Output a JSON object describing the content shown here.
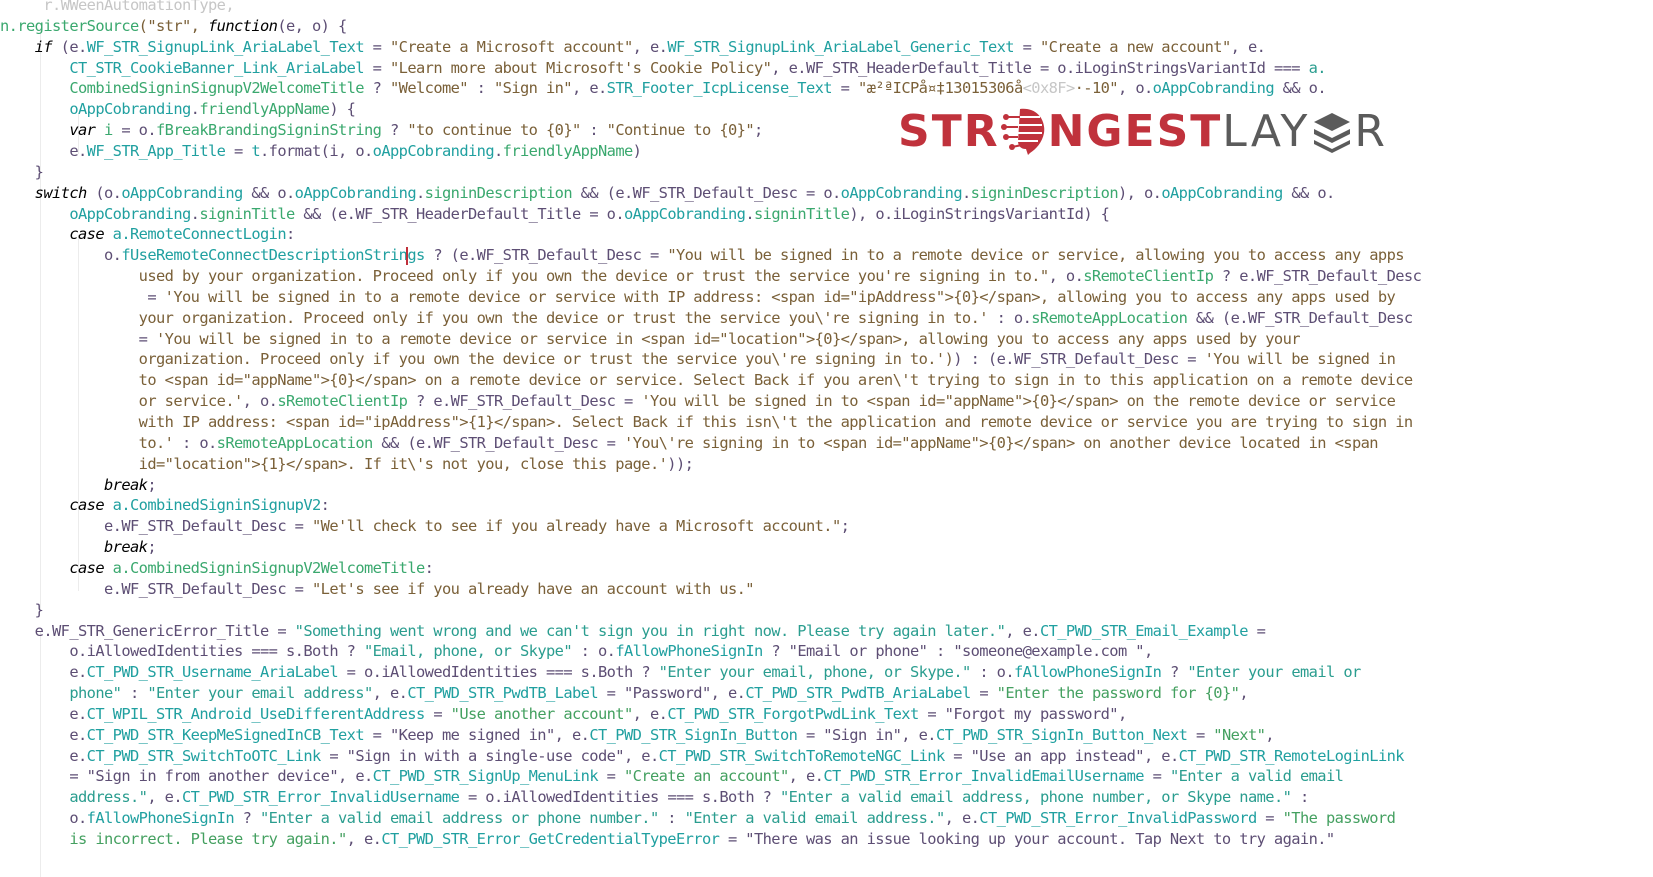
{
  "logo": {
    "part1": "STR",
    "part2": "NGEST",
    "part3": "LAY",
    "part4": "R",
    "colors": {
      "primary": "#c0323c",
      "secondary": "#5b5b5b"
    }
  },
  "code": {
    "lines": [
      [
        [
          "pl",
          "     "
        ],
        [
          "ghost",
          "r.WWeenAutomationType,"
        ]
      ],
      [
        [
          "fn",
          "n.registerSource"
        ],
        [
          "str",
          "(\"str\", "
        ],
        [
          "kw",
          "function"
        ],
        [
          "pl",
          "(e, o) {"
        ]
      ],
      [
        [
          "pl",
          "    "
        ],
        [
          "kw",
          "if"
        ],
        [
          "pl",
          " (e."
        ],
        [
          "prop",
          "WF_STR_SignupLink_AriaLabel_Text"
        ],
        [
          "pl",
          " = "
        ],
        [
          "str",
          "\"Create a Microsoft account\""
        ],
        [
          "pl",
          ", e."
        ],
        [
          "prop",
          "WF_STR_SignupLink_AriaLabel_Generic_Text"
        ],
        [
          "pl",
          " = "
        ],
        [
          "str",
          "\"Create a new account\""
        ],
        [
          "pl",
          ", e."
        ]
      ],
      [
        [
          "pl",
          "        "
        ],
        [
          "prop",
          "CT_STR_CookieBanner_Link_AriaLabel"
        ],
        [
          "pl",
          " = "
        ],
        [
          "str",
          "\"Learn more about Microsoft's Cookie Policy\""
        ],
        [
          "pl",
          ", e."
        ],
        [
          "pl",
          "WF_STR_HeaderDefault_Title"
        ],
        [
          "pl",
          " = o."
        ],
        [
          "pl",
          "iLoginStringsVariantId"
        ],
        [
          "pl",
          " === "
        ],
        [
          "teal",
          "a."
        ]
      ],
      [
        [
          "pl",
          "        "
        ],
        [
          "fn",
          "CombinedSigninSignupV2WelcomeTitle"
        ],
        [
          "pl",
          " ? "
        ],
        [
          "str",
          "\"Welcome\""
        ],
        [
          "pl",
          " : "
        ],
        [
          "str",
          "\"Sign in\""
        ],
        [
          "pl",
          ", e."
        ],
        [
          "prop",
          "STR_Footer_IcpLicense_Text"
        ],
        [
          "pl",
          " = "
        ],
        [
          "str",
          "\"æ²ªICPå¤‡13015306å"
        ],
        [
          "ghost",
          "<0x8F>"
        ],
        [
          "str",
          "·-10\""
        ],
        [
          "pl",
          ", o."
        ],
        [
          "prop",
          "oAppCobranding"
        ],
        [
          "pl",
          " && o."
        ]
      ],
      [
        [
          "pl",
          "        "
        ],
        [
          "prop",
          "oAppCobranding"
        ],
        [
          "pl",
          "."
        ],
        [
          "fn",
          "friendlyAppName"
        ],
        [
          "pl",
          ") {"
        ]
      ],
      [
        [
          "pl",
          "        "
        ],
        [
          "kw",
          "var"
        ],
        [
          "pl",
          " "
        ],
        [
          "fn",
          "i"
        ],
        [
          "pl",
          " = o."
        ],
        [
          "fn",
          "fBreakBrandingSigninString"
        ],
        [
          "pl",
          " ? "
        ],
        [
          "str",
          "\"to continue to {0}\""
        ],
        [
          "pl",
          " : "
        ],
        [
          "str",
          "\"Continue to {0}\""
        ],
        [
          "pl",
          ";"
        ]
      ],
      [
        [
          "pl",
          "        e."
        ],
        [
          "prop",
          "WF_STR_App_Title"
        ],
        [
          "pl",
          " = "
        ],
        [
          "prop",
          "t"
        ],
        [
          "pl",
          ".format(i, o."
        ],
        [
          "prop",
          "oAppCobranding"
        ],
        [
          "pl",
          "."
        ],
        [
          "fn",
          "friendlyAppName"
        ],
        [
          "pl",
          ")"
        ]
      ],
      [
        [
          "pl",
          "    }"
        ]
      ],
      [
        [
          "pl",
          "    "
        ],
        [
          "kw",
          "switch"
        ],
        [
          "pl",
          " (o."
        ],
        [
          "prop",
          "oAppCobranding"
        ],
        [
          "pl",
          " && o."
        ],
        [
          "prop",
          "oAppCobranding"
        ],
        [
          "pl",
          "."
        ],
        [
          "fn",
          "signinDescription"
        ],
        [
          "pl",
          " && (e."
        ],
        [
          "pl",
          "WF_STR_Default_Desc"
        ],
        [
          "pl",
          " = o."
        ],
        [
          "prop",
          "oAppCobranding"
        ],
        [
          "pl",
          "."
        ],
        [
          "fn",
          "signinDescription"
        ],
        [
          "pl",
          "), o."
        ],
        [
          "prop",
          "oAppCobranding"
        ],
        [
          "pl",
          " && o."
        ]
      ],
      [
        [
          "pl",
          "        "
        ],
        [
          "prop",
          "oAppCobranding"
        ],
        [
          "pl",
          "."
        ],
        [
          "fn",
          "signinTitle"
        ],
        [
          "pl",
          " && (e."
        ],
        [
          "pl",
          "WF_STR_HeaderDefault_Title"
        ],
        [
          "pl",
          " = o."
        ],
        [
          "prop",
          "oAppCobranding"
        ],
        [
          "pl",
          "."
        ],
        [
          "fn",
          "signinTitle"
        ],
        [
          "pl",
          "), o."
        ],
        [
          "pl",
          "iLoginStringsVariantId"
        ],
        [
          "pl",
          ") {"
        ]
      ],
      [
        [
          "pl",
          "        "
        ],
        [
          "kw",
          "case"
        ],
        [
          "pl",
          " "
        ],
        [
          "prop",
          "a.RemoteConnectLogin"
        ],
        [
          "pl",
          ":"
        ]
      ],
      [
        [
          "pl",
          "            o."
        ],
        [
          "prop",
          "fUseRemoteConnectDescriptionStrin"
        ],
        [
          "caret",
          ""
        ],
        [
          "prop",
          "gs"
        ],
        [
          "pl",
          " ? (e."
        ],
        [
          "pl",
          "WF_STR_Default_Desc"
        ],
        [
          "pl",
          " = "
        ],
        [
          "str",
          "\"You will be signed in to a remote device or service, allowing you to access any apps"
        ]
      ],
      [
        [
          "str",
          "                used by your organization. Proceed only if you own the device or trust the service you're signing in to.\""
        ],
        [
          "pl",
          ", o."
        ],
        [
          "fn",
          "sRemoteClientIp"
        ],
        [
          "pl",
          " ? e."
        ],
        [
          "pl",
          "WF_STR_Default_Desc"
        ]
      ],
      [
        [
          "pl",
          "                 = "
        ],
        [
          "str",
          "'You will be signed in to a remote device or service with IP address: <span id=\"ipAddress\">{0}</span>, allowing you to access any apps used by"
        ]
      ],
      [
        [
          "str",
          "                your organization. Proceed only if you own the device or trust the service you\\'re signing in to.'"
        ],
        [
          "pl",
          " : o."
        ],
        [
          "fn",
          "sRemoteAppLocation"
        ],
        [
          "pl",
          " && (e."
        ],
        [
          "pl",
          "WF_STR_Default_Desc"
        ]
      ],
      [
        [
          "pl",
          "                = "
        ],
        [
          "str",
          "'You will be signed in to a remote device or service in <span id=\"location\">{0}</span>, allowing you to access any apps used by your"
        ]
      ],
      [
        [
          "str",
          "                organization. Proceed only if you own the device or trust the service you\\'re signing in to.')"
        ],
        [
          "pl",
          ") : (e."
        ],
        [
          "pl",
          "WF_STR_Default_Desc"
        ],
        [
          "pl",
          " = "
        ],
        [
          "str",
          "'You will be signed in"
        ]
      ],
      [
        [
          "str",
          "                to <span id=\"appName\">{0}</span> on a remote device or service. Select Back if you aren\\'t trying to sign in to this application on a remote device"
        ]
      ],
      [
        [
          "str",
          "                or service.'"
        ],
        [
          "pl",
          ", o."
        ],
        [
          "fn",
          "sRemoteClientIp"
        ],
        [
          "pl",
          " ? e."
        ],
        [
          "pl",
          "WF_STR_Default_Desc"
        ],
        [
          "pl",
          " = "
        ],
        [
          "str",
          "'You will be signed in to <span id=\"appName\">{0}</span> on the remote device or service"
        ]
      ],
      [
        [
          "str",
          "                with IP address: <span id=\"ipAddress\">{1}</span>. Select Back if this isn\\'t the application and remote device or service you are trying to sign in"
        ]
      ],
      [
        [
          "str",
          "                to.'"
        ],
        [
          "pl",
          " : o."
        ],
        [
          "fn",
          "sRemoteAppLocation"
        ],
        [
          "pl",
          " && (e."
        ],
        [
          "pl",
          "WF_STR_Default_Desc"
        ],
        [
          "pl",
          " = "
        ],
        [
          "str",
          "'You\\'re signing in to <span id=\"appName\">{0}</span> on another device located in <span"
        ]
      ],
      [
        [
          "str",
          "                id=\"location\">{1}</span>. If it\\'s not you, close this page.'"
        ],
        [
          "pl",
          "));"
        ]
      ],
      [
        [
          "pl",
          "            "
        ],
        [
          "kw",
          "break"
        ],
        [
          "pl",
          ";"
        ]
      ],
      [
        [
          "pl",
          "        "
        ],
        [
          "kw",
          "case"
        ],
        [
          "pl",
          " "
        ],
        [
          "prop",
          "a.CombinedSigninSignupV2"
        ],
        [
          "pl",
          ":"
        ]
      ],
      [
        [
          "pl",
          "            e."
        ],
        [
          "pl",
          "WF_STR_Default_Desc"
        ],
        [
          "pl",
          " = "
        ],
        [
          "str",
          "\"We'll check to see if you already have a Microsoft account.\""
        ],
        [
          "pl",
          ";"
        ]
      ],
      [
        [
          "pl",
          "            "
        ],
        [
          "kw",
          "break"
        ],
        [
          "pl",
          ";"
        ]
      ],
      [
        [
          "pl",
          "        "
        ],
        [
          "kw",
          "case"
        ],
        [
          "pl",
          " "
        ],
        [
          "fn",
          "a.CombinedSigninSignupV2WelcomeTitle"
        ],
        [
          "pl",
          ":"
        ]
      ],
      [
        [
          "pl",
          "            e."
        ],
        [
          "pl",
          "WF_STR_Default_Desc"
        ],
        [
          "pl",
          " = "
        ],
        [
          "str",
          "\"Let's see if you already have an account with us.\""
        ]
      ],
      [
        [
          "pl",
          "    }"
        ]
      ],
      [
        [
          "pl",
          "    e."
        ],
        [
          "pl",
          "WF_STR_GenericError_Title"
        ],
        [
          "pl",
          " = "
        ],
        [
          "teal",
          "\"Something went wrong and we can't sign you in right now. Please try again later.\""
        ],
        [
          "pl",
          ", e."
        ],
        [
          "prop",
          "CT_PWD_STR_Email_Example"
        ],
        [
          "pl",
          " ="
        ]
      ],
      [
        [
          "pl",
          "        o."
        ],
        [
          "pl",
          "iAllowedIdentities"
        ],
        [
          "pl",
          " === s.Both ? "
        ],
        [
          "teal",
          "\"Email, phone, or Skype\""
        ],
        [
          "pl",
          " : o."
        ],
        [
          "prop",
          "fAllowPhoneSignIn"
        ],
        [
          "pl",
          " ? "
        ],
        [
          "pl",
          "\"Email or phone\""
        ],
        [
          "pl",
          " : "
        ],
        [
          "pl",
          "\"someone@example.com \""
        ],
        [
          "pl",
          ","
        ]
      ],
      [
        [
          "pl",
          "        e."
        ],
        [
          "prop",
          "CT_PWD_STR_Username_AriaLabel"
        ],
        [
          "pl",
          " = o."
        ],
        [
          "pl",
          "iAllowedIdentities"
        ],
        [
          "pl",
          " === s.Both ? "
        ],
        [
          "teal",
          "\"Enter your email, phone, or Skype.\""
        ],
        [
          "pl",
          " : o."
        ],
        [
          "prop",
          "fAllowPhoneSignIn"
        ],
        [
          "pl",
          " ? "
        ],
        [
          "teal",
          "\"Enter your email or"
        ]
      ],
      [
        [
          "teal",
          "        phone\""
        ],
        [
          "pl",
          " : "
        ],
        [
          "teal",
          "\"Enter your email address\""
        ],
        [
          "pl",
          ", e."
        ],
        [
          "prop",
          "CT_PWD_STR_PwdTB_Label"
        ],
        [
          "pl",
          " = "
        ],
        [
          "pl",
          "\"Password\""
        ],
        [
          "pl",
          ", e."
        ],
        [
          "prop",
          "CT_PWD_STR_PwdTB_AriaLabel"
        ],
        [
          "pl",
          " = "
        ],
        [
          "grn",
          "\"Enter the password for {0}\""
        ],
        [
          "pl",
          ","
        ]
      ],
      [
        [
          "pl",
          "        e."
        ],
        [
          "prop",
          "CT_WPIL_STR_Android_UseDifferentAddress"
        ],
        [
          "pl",
          " = "
        ],
        [
          "grn",
          "\"Use another account\""
        ],
        [
          "pl",
          ", e."
        ],
        [
          "prop",
          "CT_PWD_STR_ForgotPwdLink_Text"
        ],
        [
          "pl",
          " = "
        ],
        [
          "pl",
          "\"Forgot my password\""
        ],
        [
          "pl",
          ","
        ]
      ],
      [
        [
          "pl",
          "        e."
        ],
        [
          "prop",
          "CT_PWD_STR_KeepMeSignedInCB_Text"
        ],
        [
          "pl",
          " = "
        ],
        [
          "pl",
          "\"Keep me signed in\""
        ],
        [
          "pl",
          ", e."
        ],
        [
          "prop",
          "CT_PWD_STR_SignIn_Button"
        ],
        [
          "pl",
          " = "
        ],
        [
          "pl",
          "\"Sign in\""
        ],
        [
          "pl",
          ", e."
        ],
        [
          "prop",
          "CT_PWD_STR_SignIn_Button_Next"
        ],
        [
          "pl",
          " = "
        ],
        [
          "grn",
          "\"Next\""
        ],
        [
          "pl",
          ","
        ]
      ],
      [
        [
          "pl",
          "        e."
        ],
        [
          "prop",
          "CT_PWD_STR_SwitchToOTC_Link"
        ],
        [
          "pl",
          " = "
        ],
        [
          "pl",
          "\"Sign in with a single-use code\""
        ],
        [
          "pl",
          ", e."
        ],
        [
          "prop",
          "CT_PWD_STR_SwitchToRemoteNGC_Link"
        ],
        [
          "pl",
          " = "
        ],
        [
          "pl",
          "\"Use an app instead\""
        ],
        [
          "pl",
          ", e."
        ],
        [
          "prop",
          "CT_PWD_STR_RemoteLoginLink"
        ]
      ],
      [
        [
          "pl",
          "        = "
        ],
        [
          "pl",
          "\"Sign in from another device\""
        ],
        [
          "pl",
          ", e."
        ],
        [
          "prop",
          "CT_PWD_STR_SignUp_MenuLink"
        ],
        [
          "pl",
          " = "
        ],
        [
          "grn",
          "\"Create an account\""
        ],
        [
          "pl",
          ", e."
        ],
        [
          "prop",
          "CT_PWD_STR_Error_InvalidEmailUsername"
        ],
        [
          "pl",
          " = "
        ],
        [
          "teal",
          "\"Enter a valid email"
        ]
      ],
      [
        [
          "teal",
          "        address.\""
        ],
        [
          "pl",
          ", e."
        ],
        [
          "prop",
          "CT_PWD_STR_Error_InvalidUsername"
        ],
        [
          "pl",
          " = o."
        ],
        [
          "pl",
          "iAllowedIdentities"
        ],
        [
          "pl",
          " === s.Both ? "
        ],
        [
          "teal",
          "\"Enter a valid email address, phone number, or Skype name.\""
        ],
        [
          "pl",
          " :"
        ]
      ],
      [
        [
          "pl",
          "        o."
        ],
        [
          "prop",
          "fAllowPhoneSignIn"
        ],
        [
          "pl",
          " ? "
        ],
        [
          "teal",
          "\"Enter a valid email address or phone number.\""
        ],
        [
          "pl",
          " : "
        ],
        [
          "teal",
          "\"Enter a valid email address.\""
        ],
        [
          "pl",
          ", e."
        ],
        [
          "prop",
          "CT_PWD_STR_Error_InvalidPassword"
        ],
        [
          "pl",
          " = "
        ],
        [
          "grn",
          "\"The password"
        ]
      ],
      [
        [
          "grn",
          "        is incorrect. Please try again.\""
        ],
        [
          "pl",
          ", e."
        ],
        [
          "prop",
          "CT_PWD_STR_Error_GetCredentialTypeError"
        ],
        [
          "pl",
          " = "
        ],
        [
          "pl",
          "\"There was an issue looking up your account. Tap Next to try again.\""
        ]
      ]
    ]
  }
}
